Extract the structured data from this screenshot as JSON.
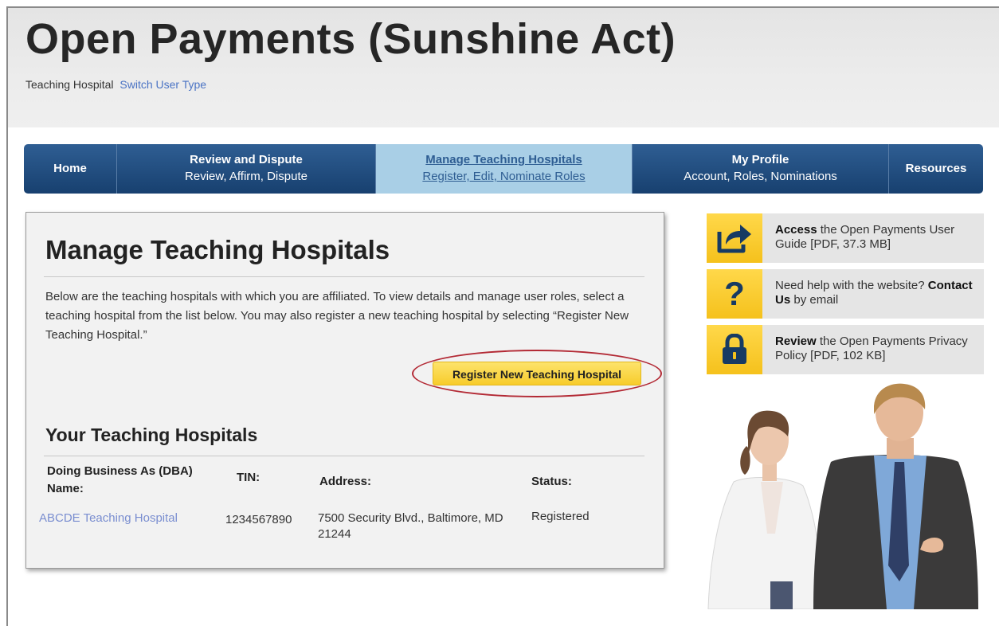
{
  "header": {
    "title": "Open Payments (Sunshine Act)",
    "user_type": "Teaching Hospital",
    "switch_link": "Switch User Type"
  },
  "nav": [
    {
      "title": "Home",
      "subtitle": "",
      "active": false
    },
    {
      "title": "Review and Dispute",
      "subtitle": "Review, Affirm, Dispute",
      "active": false
    },
    {
      "title": "Manage Teaching Hospitals",
      "subtitle": "Register, Edit, Nominate Roles",
      "active": true
    },
    {
      "title": "My Profile",
      "subtitle": "Account, Roles, Nominations",
      "active": false
    },
    {
      "title": "Resources",
      "subtitle": "",
      "active": false
    }
  ],
  "main": {
    "title": "Manage Teaching Hospitals",
    "intro": "Below are the teaching hospitals with which you are affiliated. To view details and manage user roles, select a teaching hospital from the list below. You may also register a new teaching hospital by selecting “Register New Teaching Hospital.”",
    "register_button": "Register New Teaching Hospital",
    "section_title": "Your Teaching Hospitals",
    "table": {
      "headers": [
        "Doing Business As (DBA) Name:",
        "TIN:",
        "Address:",
        "Status:"
      ],
      "rows": [
        {
          "dba": "ABCDE Teaching Hospital",
          "tin": "1234567890",
          "address": "7500 Security Blvd., Baltimore, MD 21244",
          "status": "Registered"
        }
      ]
    }
  },
  "sidebar": [
    {
      "icon": "share-icon",
      "bold": "Access",
      "text": " the Open Payments User Guide [PDF, 37.3 MB]"
    },
    {
      "icon": "question-icon",
      "pre": "Need help with the website? ",
      "bold": "Contact Us",
      "text": " by email"
    },
    {
      "icon": "lock-icon",
      "bold": "Review",
      "text": " the Open Payments Privacy Policy [PDF, 102 KB]"
    }
  ],
  "colors": {
    "nav_bg": "#1f4b7c",
    "nav_active_bg": "#a9cfe6",
    "button_yellow": "#f9d63e",
    "highlight_red": "#b32a35",
    "link_blue": "#4a73c4"
  }
}
